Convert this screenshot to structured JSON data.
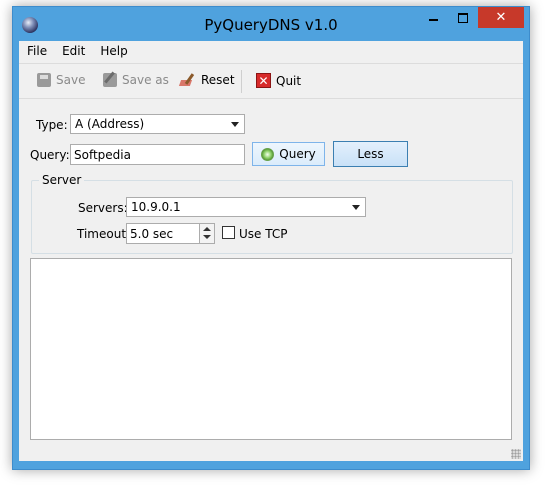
{
  "window": {
    "title": "PyQueryDNS v1.0"
  },
  "menu": {
    "file": "File",
    "edit": "Edit",
    "help": "Help"
  },
  "toolbar": {
    "save": "Save",
    "save_as": "Save as",
    "reset": "Reset",
    "quit": "Quit"
  },
  "form": {
    "type_label": "Type:",
    "type_value": "A (Address)",
    "query_label": "Query:",
    "query_value": "Softpedia",
    "query_button": "Query",
    "less_button": "Less"
  },
  "server": {
    "group_title": "Server",
    "servers_label": "Servers:",
    "servers_value": "10.9.0.1",
    "timeout_label": "Timeout:",
    "timeout_value": "5.0 sec",
    "use_tcp_label": "Use TCP",
    "use_tcp_checked": false
  },
  "output": {
    "text": ""
  }
}
